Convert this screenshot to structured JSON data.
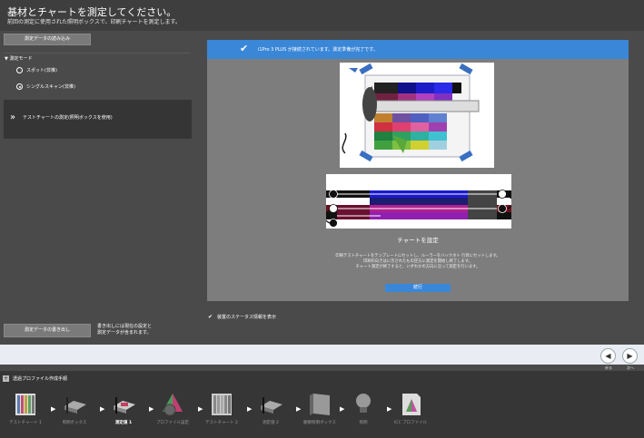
{
  "header": {
    "title": "基材とチャートを測定してください。",
    "subtitle": "前回の測定に使用された照明ボックスで、印刷チャートを測定します。"
  },
  "left": {
    "load_button": "測定データの読み込み",
    "mode_heading": "測定モード",
    "modes": [
      {
        "label": "スポット(非推)",
        "selected": false
      },
      {
        "label": "シングルスキャン(非推)",
        "selected": true
      }
    ],
    "measure_label": "テストチャートの測定(照明ボックスを使用)",
    "write_button": "測定データの書き出し",
    "write_note_1": "書き出しには現在の設定と",
    "write_note_2": "測定データが含まれます。"
  },
  "content": {
    "banner_text": "i1Pro 3 PLUS が接続されています。測定準備が完了です。",
    "chart_title": "チャートを設定",
    "instr_1": "印刷テストチャートをテンプレートにセットし、ルーラーをバックホト 行目にセットします。",
    "instr_2": "印刷の向きはに示されたもの逆方に測定を開始し終了します。",
    "instr_3": "チャート測定が終了すると、いずれかの方向に沿って測定を行います。",
    "next_button": "続行",
    "status_check": "装置のステータス情報を表示",
    "status_checked": true
  },
  "nav": {
    "back_label": "戻る",
    "next_label": "次へ"
  },
  "workflow": {
    "title": "透過プロファイル作成手順",
    "steps": [
      {
        "label": "テストチャート 1",
        "icon": "test-chart-icon",
        "active": false
      },
      {
        "label": "照明ボックス",
        "icon": "lightbox-icon",
        "active": false
      },
      {
        "label": "測定値 1",
        "icon": "measure-icon",
        "active": true
      },
      {
        "label": "プロファイル設定",
        "icon": "profile-settings-icon",
        "active": false
      },
      {
        "label": "テストチャート 2",
        "icon": "test-chart-icon",
        "active": false
      },
      {
        "label": "測定値 2",
        "icon": "measure-icon",
        "active": false
      },
      {
        "label": "観察照明ボックス",
        "icon": "viewing-lightbox-icon",
        "active": false
      },
      {
        "label": "照明",
        "icon": "lightbulb-icon",
        "active": false
      },
      {
        "label": "ICC プロファイル",
        "icon": "icc-profile-icon",
        "active": false
      }
    ]
  },
  "colors": {
    "accent": "#3a87d8",
    "background": "#4a4a4a",
    "panel": "#353535"
  }
}
